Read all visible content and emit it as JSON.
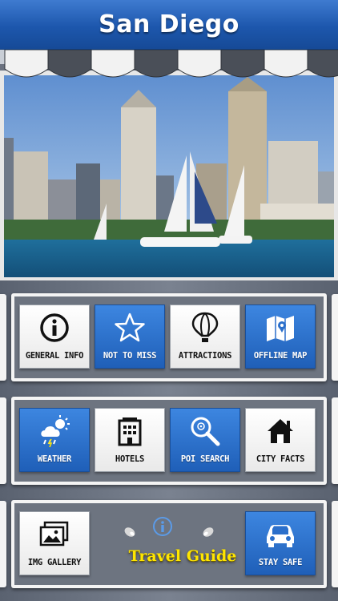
{
  "header": {
    "title": "San Diego"
  },
  "colors": {
    "header_blue": "#1d57ad",
    "tile_blue": "#2b6fcb",
    "logo_yellow": "#ffe600"
  },
  "rows": [
    {
      "tiles": [
        {
          "label": "GENERAL INFO",
          "icon": "info-icon",
          "style": "white"
        },
        {
          "label": "NOT TO MISS",
          "icon": "star-icon",
          "style": "blue"
        },
        {
          "label": "ATTRACTIONS",
          "icon": "balloon-icon",
          "style": "white"
        },
        {
          "label": "OFFLINE MAP",
          "icon": "map-icon",
          "style": "blue"
        }
      ]
    },
    {
      "tiles": [
        {
          "label": "WEATHER",
          "icon": "weather-icon",
          "style": "blue"
        },
        {
          "label": "HOTELS",
          "icon": "hotel-icon",
          "style": "white"
        },
        {
          "label": "POI SEARCH",
          "icon": "search-icon",
          "style": "blue"
        },
        {
          "label": "CITY FACTS",
          "icon": "home-icon",
          "style": "white"
        }
      ]
    },
    {
      "tiles": [
        {
          "label": "IMG GALLERY",
          "icon": "gallery-icon",
          "style": "white"
        },
        {
          "label": "STAY SAFE",
          "icon": "car-icon",
          "style": "blue"
        }
      ]
    }
  ],
  "logo": {
    "text": "Travel Guide",
    "info_icon": "info-icon"
  }
}
